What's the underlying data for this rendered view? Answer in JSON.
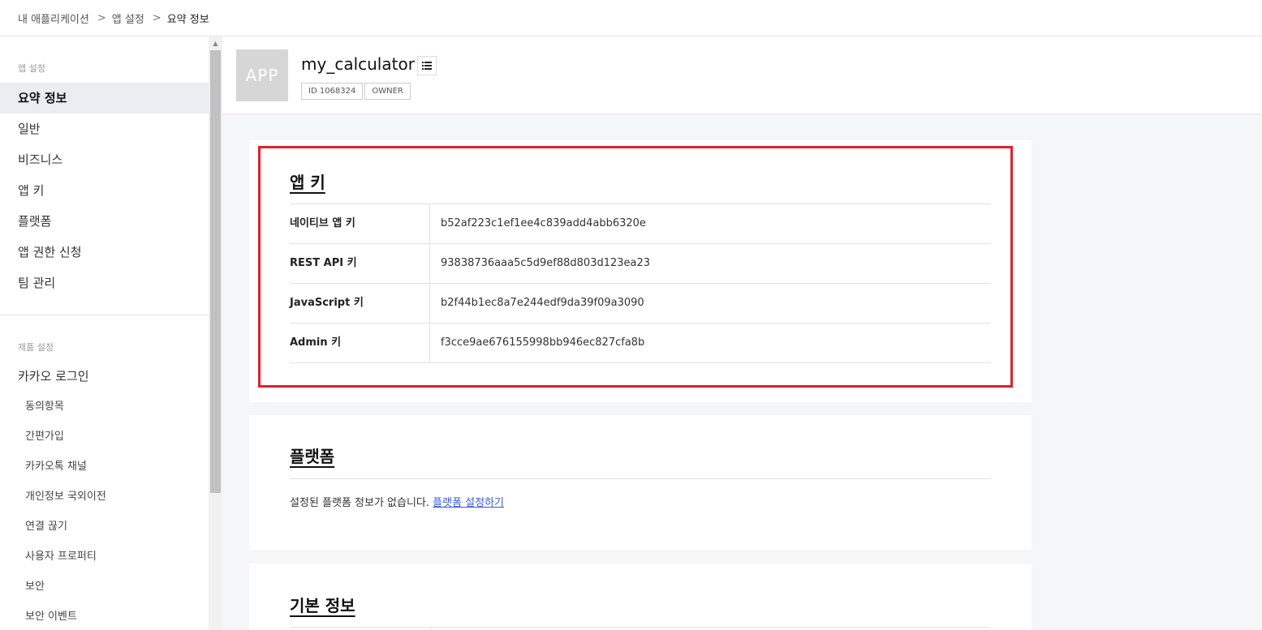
{
  "breadcrumb": {
    "items": [
      "내 애플리케이션",
      "앱 설정",
      "요약 정보"
    ],
    "separator": ">"
  },
  "sidebar": {
    "app_section_label": "앱 설정",
    "app_items": [
      {
        "label": "요약 정보",
        "active": true
      },
      {
        "label": "일반"
      },
      {
        "label": "비즈니스"
      },
      {
        "label": "앱 키"
      },
      {
        "label": "플랫폼"
      },
      {
        "label": "앱 권한 신청"
      },
      {
        "label": "팀 관리"
      }
    ],
    "product_section_label": "제품 설정",
    "product_main": "카카오 로그인",
    "product_subitems": [
      "동의항목",
      "간편가입",
      "카카오톡 채널",
      "개인정보 국외이전",
      "연결 끊기",
      "사용자 프로퍼티",
      "보안",
      "보안 이벤트"
    ]
  },
  "app": {
    "thumbnail_text": "APP",
    "name": "my_calculator",
    "id_badge": "ID 1068324",
    "role_badge": "OWNER",
    "list_icon": "list-icon"
  },
  "app_keys": {
    "title": "앱 키",
    "rows": [
      {
        "name": "네이티브 앱 키",
        "value": "b52af223c1ef1ee4c839add4abb6320e"
      },
      {
        "name": "REST API 키",
        "value": "93838736aaa5c5d9ef88d803d123ea23"
      },
      {
        "name": "JavaScript 키",
        "value": "b2f44b1ec8a7e244edf9da39f09a3090"
      },
      {
        "name": "Admin 키",
        "value": "f3cce9ae676155998bb946ec827cfa8b"
      }
    ],
    "highlight_color": "#e0202c"
  },
  "platform": {
    "title": "플랫폼",
    "empty_text": "설정된 플랫폼 정보가 없습니다.",
    "link_text": "플랫폼 설정하기"
  },
  "basic_info": {
    "title": "기본 정보"
  },
  "colors": {
    "active_nav_bg": "#eaedf2",
    "main_bg": "#f5f6f7",
    "link": "#3a5bd9"
  }
}
